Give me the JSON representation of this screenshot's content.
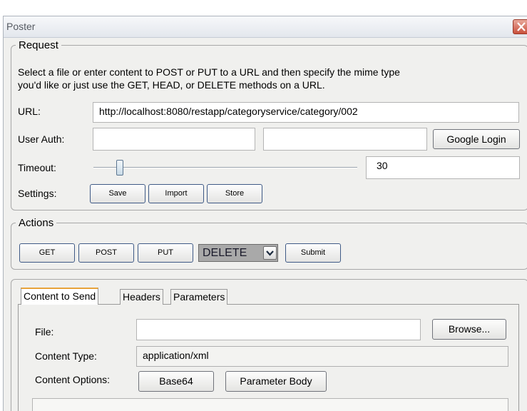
{
  "window": {
    "title": "Poster"
  },
  "request": {
    "legend": "Request",
    "description": "Select a file or enter content to POST or PUT to a URL and then specify the mime type you'd like or just use the GET, HEAD, or DELETE methods on a URL.",
    "description_line1": "Select a file or enter content to POST or PUT to a URL and then specify the mime type",
    "description_line2": "you'd like or just use the GET, HEAD, or DELETE methods on a URL.",
    "url_label": "URL:",
    "url_value": "http://localhost:8080/restapp/categoryservice/category/002",
    "user_auth_label": "User Auth:",
    "user_value": "",
    "password_value": "",
    "google_login_label": "Google Login",
    "timeout_label": "Timeout:",
    "timeout_value": "30",
    "timeout_slider_fraction": 0.1,
    "settings_label": "Settings:",
    "save_label": "Save",
    "import_label": "Import",
    "store_label": "Store"
  },
  "actions": {
    "legend": "Actions",
    "get_label": "GET",
    "post_label": "POST",
    "put_label": "PUT",
    "method_selected": "DELETE",
    "submit_label": "Submit"
  },
  "content": {
    "tabs": [
      {
        "label": "Content to Send",
        "active": true
      },
      {
        "label": "Headers",
        "active": false
      },
      {
        "label": "Parameters",
        "active": false
      }
    ],
    "file_label": "File:",
    "file_value": "",
    "browse_label": "Browse...",
    "content_type_label": "Content Type:",
    "content_type_value": "application/xml",
    "content_options_label": "Content Options:",
    "base64_label": "Base64",
    "parameter_body_label": "Parameter Body"
  },
  "colors": {
    "window_bg": "#f0f0ee",
    "close_button": "#c9503c",
    "active_tab_accent": "#e8a33b",
    "button_border": "#3f5a86"
  }
}
